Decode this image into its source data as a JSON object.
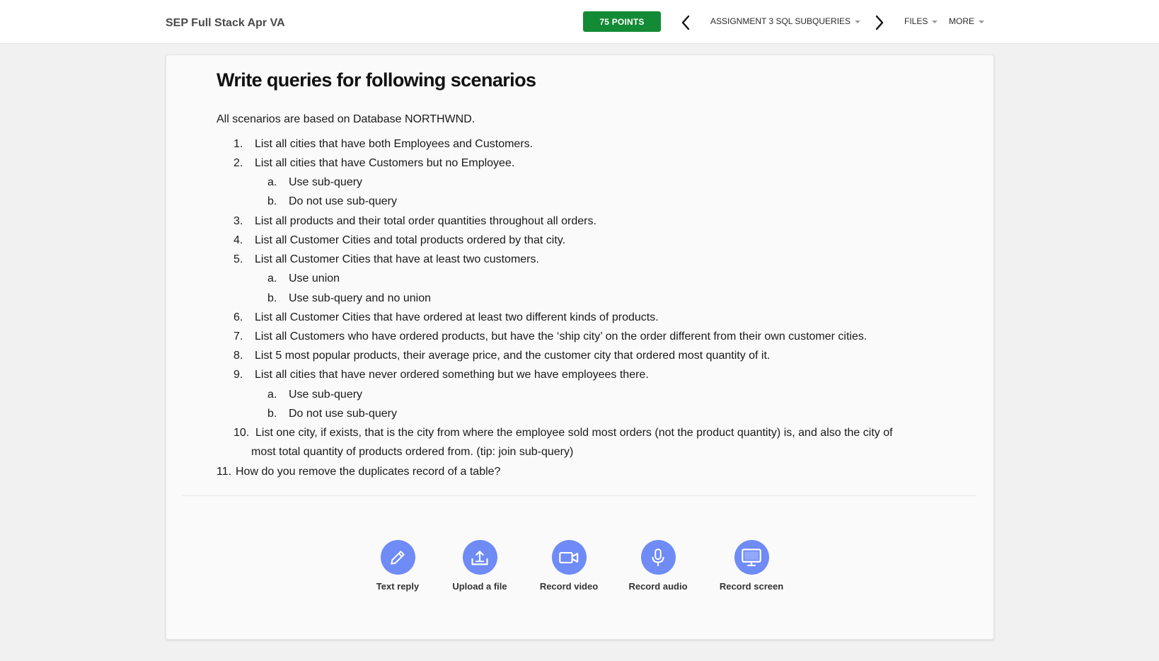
{
  "header": {
    "course_title": "SEP Full Stack Apr VA",
    "points": "75 POINTS",
    "assignment_menu": "ASSIGNMENT 3 SQL SUBQUERIES",
    "files_menu": "FILES",
    "more_menu": "MORE"
  },
  "content": {
    "title": "Write queries for following scenarios",
    "intro": "All scenarios are based on Database NORTHWND.",
    "items": [
      {
        "marker": "1.",
        "text": "List all cities that have both Employees and Customers."
      },
      {
        "marker": "2.",
        "text": "List all cities that have Customers but no Employee."
      },
      {
        "marker": "a.",
        "text": "Use sub-query"
      },
      {
        "marker": "b.",
        "text": "Do not use sub-query"
      },
      {
        "marker": "3.",
        "text": "List all products and their total order quantities throughout all orders."
      },
      {
        "marker": "4.",
        "text": "List all Customer Cities and total products ordered by that city."
      },
      {
        "marker": "5.",
        "text": "List all Customer Cities that have at least two customers."
      },
      {
        "marker": "a.",
        "text": "Use union"
      },
      {
        "marker": "b.",
        "text": "Use sub-query and no union"
      },
      {
        "marker": "6.",
        "text": "List all Customer Cities that have ordered at least two different kinds of products."
      },
      {
        "marker": "7.",
        "text": "List all Customers who have ordered products, but have the ‘ship city’ on the order different from their own customer cities."
      },
      {
        "marker": "8.",
        "text": "List 5 most popular products, their average price, and the customer city that ordered most quantity of it."
      },
      {
        "marker": "9.",
        "text": "List all cities that have never ordered something but we have employees there."
      },
      {
        "marker": "a.",
        "text": "Use sub-query"
      },
      {
        "marker": "b.",
        "text": "Do not use sub-query"
      },
      {
        "marker": "10.",
        "text": "List one city, if exists, that is the city from where the employee sold most orders (not the product quantity) is, and also the city of"
      },
      {
        "marker": "",
        "text": "most total quantity of products ordered from. (tip: join  sub-query)"
      },
      {
        "marker": "11.",
        "text": "How do you remove the duplicates record of a table?"
      }
    ]
  },
  "actions": [
    {
      "label": "Text reply",
      "icon": "pencil-icon"
    },
    {
      "label": "Upload a file",
      "icon": "upload-icon"
    },
    {
      "label": "Record video",
      "icon": "video-camera-icon"
    },
    {
      "label": "Record audio",
      "icon": "microphone-icon"
    },
    {
      "label": "Record screen",
      "icon": "monitor-icon"
    }
  ],
  "colors": {
    "points_badge": "#138a36",
    "action_circle": "#6e8bf6"
  }
}
